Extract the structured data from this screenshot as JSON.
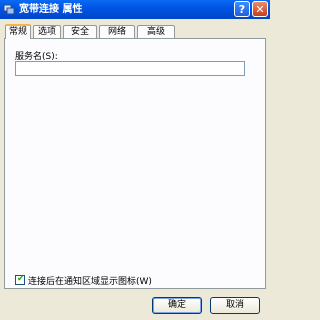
{
  "window": {
    "title": "宽带连接 属性",
    "help_label": "?",
    "close_label": "✕",
    "colors": {
      "titlebar": "#0055e5",
      "face": "#ece9d8"
    }
  },
  "tabs": [
    {
      "label": "常规",
      "active": true
    },
    {
      "label": "选项",
      "active": false
    },
    {
      "label": "安全",
      "active": false
    },
    {
      "label": "网络",
      "active": false
    },
    {
      "label": "高级",
      "active": false
    }
  ],
  "general": {
    "service_name_label": "服务名(S):",
    "service_name_value": "",
    "notify_icon_label": "连接后在通知区域显示图标(W)",
    "notify_icon_checked": true
  },
  "buttons": {
    "ok": "确定",
    "cancel": "取消"
  }
}
